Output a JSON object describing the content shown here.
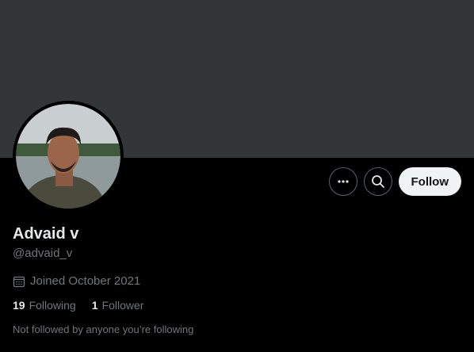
{
  "profile": {
    "name": "Advaid v",
    "handle": "@advaid_v",
    "joined": "Joined October 2021",
    "following_count": "19",
    "following_label": "Following",
    "followers_count": "1",
    "followers_label": "Follower",
    "mutuals_note": "Not followed by anyone you’re following"
  },
  "actions": {
    "more_icon": "more-dots-icon",
    "search_icon": "search-icon",
    "follow_label": "Follow"
  },
  "colors": {
    "banner": "#333639",
    "background": "#000000",
    "primary_text": "#e7e9ea",
    "secondary_text": "#71767b",
    "follow_button_bg": "#eff3f4"
  }
}
